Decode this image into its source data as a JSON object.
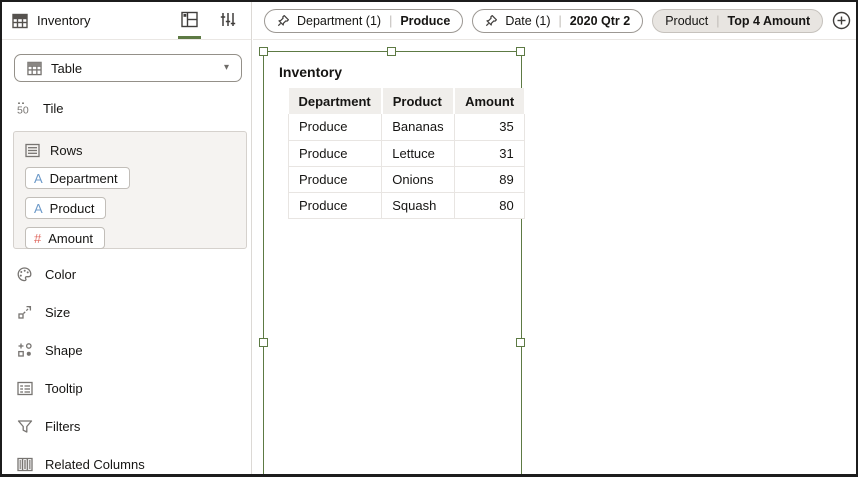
{
  "sidebar": {
    "title": "Inventory",
    "viz_type": {
      "selected": "Table"
    },
    "tile": {
      "label": "Tile",
      "icon_glyph": "50"
    },
    "rows_section": {
      "label": "Rows",
      "fields": [
        {
          "label": "Department",
          "glyph": "A",
          "type": "attribute"
        },
        {
          "label": "Product",
          "glyph": "A",
          "type": "attribute"
        },
        {
          "label": "Amount",
          "glyph": "#",
          "type": "measure"
        }
      ]
    },
    "properties": [
      {
        "label": "Color"
      },
      {
        "label": "Size"
      },
      {
        "label": "Shape"
      },
      {
        "label": "Tooltip"
      },
      {
        "label": "Filters"
      },
      {
        "label": "Related Columns"
      }
    ]
  },
  "filter_bar": {
    "filters": [
      {
        "name": "Department (1)",
        "value": "Produce",
        "pinned": true,
        "selected": false
      },
      {
        "name": "Date (1)",
        "value": "2020 Qtr 2",
        "pinned": true,
        "selected": false
      },
      {
        "name": "Product",
        "value": "Top 4 Amount",
        "pinned": false,
        "selected": true
      }
    ],
    "separator": "|"
  },
  "viz": {
    "title": "Inventory",
    "table": {
      "columns": [
        "Department",
        "Product",
        "Amount"
      ],
      "rows": [
        [
          "Produce",
          "Bananas",
          "35"
        ],
        [
          "Produce",
          "Lettuce",
          "31"
        ],
        [
          "Produce",
          "Onions",
          "89"
        ],
        [
          "Produce",
          "Squash",
          "80"
        ]
      ]
    }
  },
  "colors": {
    "accent_green": "#5d7a44",
    "attribute_blue": "#6d9ac9",
    "measure_red": "#e0685f",
    "selected_pill_bg": "#e8e5e1",
    "table_header_bg": "#f0eeeb"
  },
  "glyphs": {
    "caret_down": "▾"
  }
}
